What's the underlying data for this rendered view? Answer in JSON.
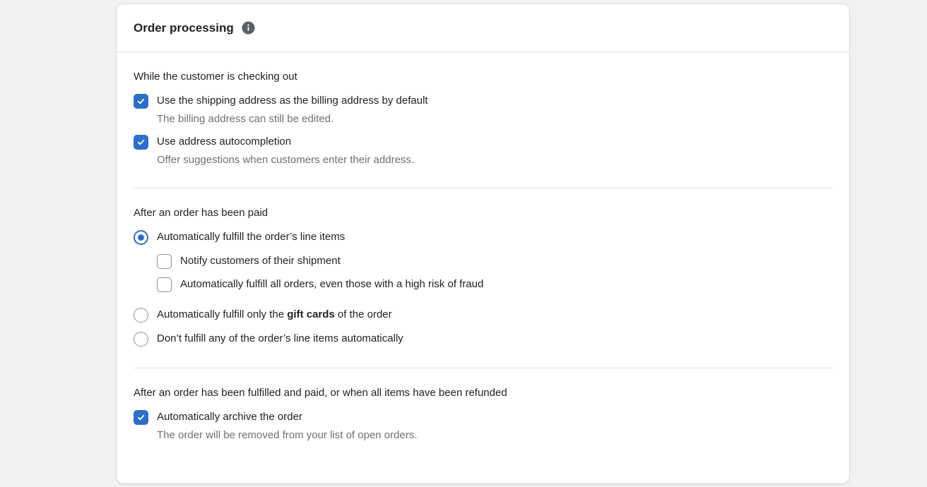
{
  "card": {
    "title": "Order processing",
    "title_icon": "info-icon"
  },
  "checkout_section": {
    "heading": "While the customer is checking out",
    "options": [
      {
        "label": "Use the shipping address as the billing address by default",
        "help": "The billing address can still be edited.",
        "checked": true
      },
      {
        "label": "Use address autocompletion",
        "help": "Offer suggestions when customers enter their address.",
        "checked": true
      }
    ]
  },
  "paid_section": {
    "heading": "After an order has been paid",
    "radio_auto_fulfill_label": "Automatically fulfill the order’s line items",
    "nested": [
      {
        "label": "Notify customers of their shipment",
        "checked": false
      },
      {
        "label": "Automatically fulfill all orders, even those with a high risk of fraud",
        "checked": false
      }
    ],
    "radio_gift_cards": {
      "prefix": "Automatically fulfill only the ",
      "bold": "gift cards",
      "suffix": " of the order"
    },
    "radio_none_label": "Don’t fulfill any of the order’s line items automatically",
    "selected": "auto_fulfill"
  },
  "archive_section": {
    "heading": "After an order has been fulfilled and paid, or when all items have been refunded",
    "option": {
      "label": "Automatically archive the order",
      "help": "The order will be removed from your list of open orders.",
      "checked": true
    }
  },
  "colors": {
    "accent": "#2c6ecb",
    "text": "#202223",
    "subdued": "#6d7175",
    "background": "#f1f1f1"
  }
}
